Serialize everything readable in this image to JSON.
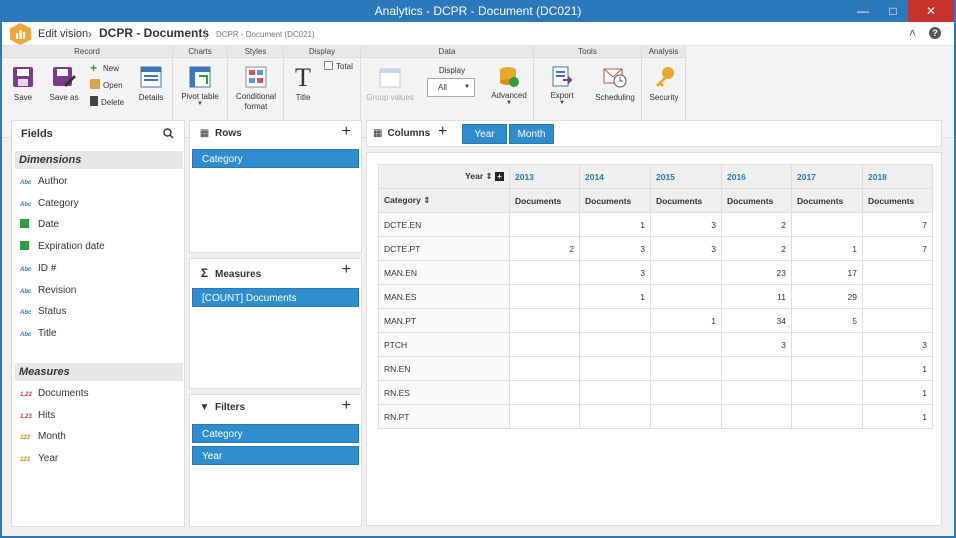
{
  "window": {
    "title": "Analytics - DCPR - Document (DC021)",
    "minimize": "—",
    "maximize": "□",
    "close": "✕"
  },
  "header": {
    "edit_vision": "Edit vision",
    "doc_title": "DCPR - Documents",
    "doc_sub": "DCPR - Document (DC021)",
    "collapse": "˄",
    "help": "?"
  },
  "ribbon": {
    "groups": {
      "record": "Record",
      "charts": "Charts",
      "styles": "Styles",
      "display": "Display",
      "data": "Data",
      "tools": "Tools",
      "analysis": "Analysis"
    },
    "save": "Save",
    "save_as": "Save as",
    "new": "New",
    "open": "Open",
    "delete": "Delete",
    "details": "Details",
    "pivot_table": "Pivot table",
    "conditional_format": "Conditional format",
    "title": "Title",
    "total": "Total",
    "group_values": "Group values",
    "display_label": "Display",
    "display_value": "All",
    "advanced": "Advanced",
    "export": "Export",
    "scheduling": "Scheduling",
    "security": "Security"
  },
  "fields": {
    "title": "Fields",
    "dimensions_label": "Dimensions",
    "dimensions": [
      {
        "name": "Author",
        "type": "Abc"
      },
      {
        "name": "Category",
        "type": "Abc"
      },
      {
        "name": "Date",
        "type": "date"
      },
      {
        "name": "Expiration date",
        "type": "date"
      },
      {
        "name": "ID #",
        "type": "Abc"
      },
      {
        "name": "Revision",
        "type": "Abc"
      },
      {
        "name": "Status",
        "type": "Abc"
      },
      {
        "name": "Title",
        "type": "Abc"
      }
    ],
    "measures_label": "Measures",
    "measures": [
      {
        "name": "Documents",
        "type": "1,23"
      },
      {
        "name": "Hits",
        "type": "1,23"
      },
      {
        "name": "Month",
        "type": "123"
      },
      {
        "name": "Year",
        "type": "123"
      }
    ]
  },
  "rows_zone": {
    "title": "Rows",
    "items": [
      "Category"
    ]
  },
  "measures_zone": {
    "title": "Measures",
    "items": [
      "[COUNT] Documents"
    ]
  },
  "filters_zone": {
    "title": "Filters",
    "items": [
      "Category",
      "Year"
    ]
  },
  "columns_zone": {
    "title": "Columns",
    "items": [
      "Year",
      "Month"
    ]
  },
  "pivot": {
    "year_header": "Year",
    "category_header": "Category",
    "years": [
      "2013",
      "2014",
      "2015",
      "2016",
      "2017",
      "2018"
    ],
    "measure_label": "Documents",
    "rows": [
      {
        "category": "DCTE.EN",
        "values": [
          "",
          "1",
          "3",
          "2",
          "",
          "7"
        ]
      },
      {
        "category": "DCTE.PT",
        "values": [
          "2",
          "3",
          "3",
          "2",
          "1",
          "7"
        ]
      },
      {
        "category": "MAN.EN",
        "values": [
          "",
          "3",
          "",
          "23",
          "17",
          ""
        ]
      },
      {
        "category": "MAN.ES",
        "values": [
          "",
          "1",
          "",
          "11",
          "29",
          ""
        ]
      },
      {
        "category": "MAN.PT",
        "values": [
          "",
          "",
          "1",
          "34",
          "5",
          ""
        ]
      },
      {
        "category": "PTCH",
        "values": [
          "",
          "",
          "",
          "3",
          "",
          "3"
        ]
      },
      {
        "category": "RN.EN",
        "values": [
          "",
          "",
          "",
          "",
          "",
          "1"
        ]
      },
      {
        "category": "RN.ES",
        "values": [
          "",
          "",
          "",
          "",
          "",
          "1"
        ]
      },
      {
        "category": "RN.PT",
        "values": [
          "",
          "",
          "",
          "",
          "",
          "1"
        ]
      }
    ]
  }
}
